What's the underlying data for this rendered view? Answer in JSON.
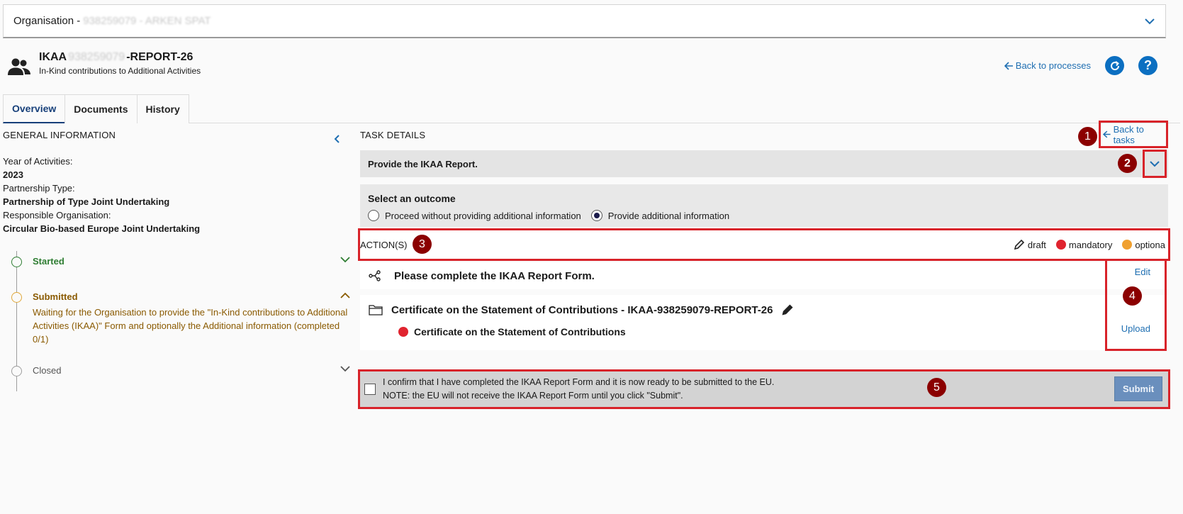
{
  "org_bar": {
    "label": "Organisation - ",
    "masked": "938259079 - ARKEN SPAT"
  },
  "header": {
    "title_prefix": "IKAA",
    "title_masked": "938259079",
    "title_suffix": "-REPORT-26",
    "subtitle": "In-Kind contributions to Additional Activities",
    "back_to_processes": "Back to processes"
  },
  "tabs": [
    {
      "label": "Overview",
      "active": true
    },
    {
      "label": "Documents",
      "active": false
    },
    {
      "label": "History",
      "active": false
    }
  ],
  "general": {
    "title": "GENERAL INFORMATION",
    "year_label": "Year of Activities:",
    "year_value": "2023",
    "ptype_label": "Partnership Type:",
    "ptype_value": "Partnership of Type Joint Undertaking",
    "org_label": "Responsible Organisation:",
    "org_value": "Circular Bio-based Europe Joint Undertaking"
  },
  "timeline": {
    "started": "Started",
    "submitted": "Submitted",
    "submitted_desc": "Waiting for the Organisation to provide the \"In-Kind contributions to Additional Activities (IKAA)\" Form and optionally the Additional information (completed 0/1)",
    "closed": "Closed"
  },
  "task": {
    "title": "TASK DETAILS",
    "back_to_tasks": "Back to tasks",
    "task_name": "Provide the IKAA Report.",
    "outcome_label": "Select an outcome",
    "outcome_options": [
      "Proceed without providing additional information",
      "Provide additional information"
    ],
    "selected_outcome": "Provide additional information",
    "actions_label": "ACTION(S)",
    "legend": {
      "draft": "draft",
      "mandatory": "mandatory",
      "optional": "optiona"
    },
    "action1": "Please complete the IKAA Report Form.",
    "action1_link": "Edit",
    "action2": "Certificate on the Statement of Contributions - IKAA-938259079-REPORT-26",
    "action2_sub": "Certificate on the Statement of Contributions",
    "action2_link": "Upload",
    "confirm_line1": "I confirm that I have completed the IKAA Report Form and it is now ready to be submitted to the EU.",
    "confirm_line2": "NOTE: the EU will not receive the IKAA Report Form until you click \"Submit\".",
    "submit": "Submit"
  },
  "badges": [
    "1",
    "2",
    "3",
    "4",
    "5"
  ],
  "colors": {
    "accent": "#1f6fb2",
    "annotation": "#d8232a",
    "badge": "#8b0000",
    "mandatory": "#e0242f",
    "optional": "#f0a030"
  }
}
